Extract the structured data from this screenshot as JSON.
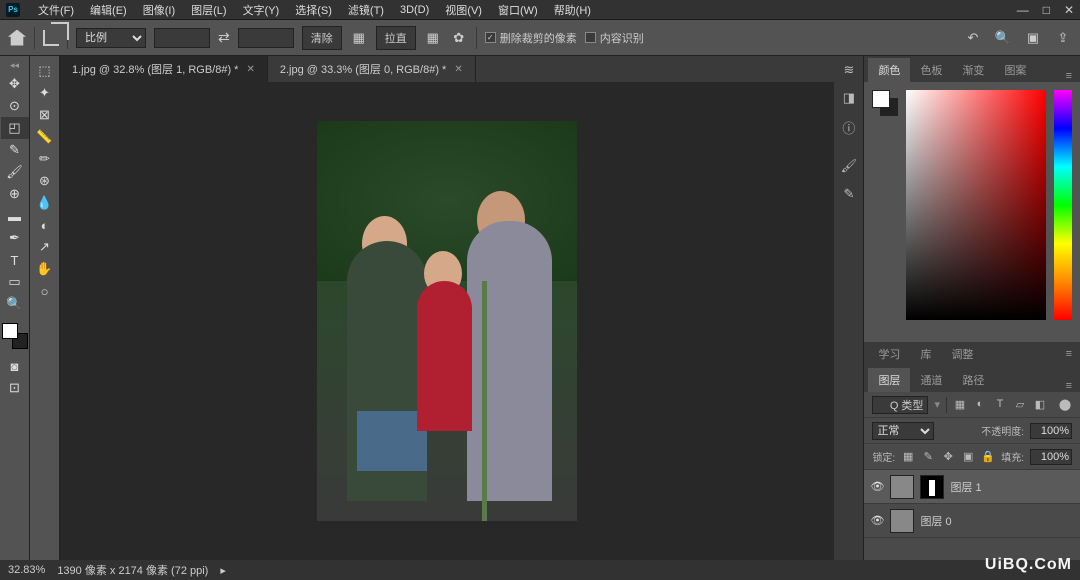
{
  "app": {
    "name": "Ps"
  },
  "menu": [
    "文件(F)",
    "编辑(E)",
    "图像(I)",
    "图层(L)",
    "文字(Y)",
    "选择(S)",
    "滤镜(T)",
    "3D(D)",
    "视图(V)",
    "窗口(W)",
    "帮助(H)"
  ],
  "winbtns": {
    "min": "—",
    "max": "□",
    "close": "✕"
  },
  "optbar": {
    "preset": "比例",
    "swap": "⇄",
    "clear": "清除",
    "straight": "拉直",
    "chk1": "删除裁剪的像素",
    "chk2": "内容识别"
  },
  "tabs": [
    {
      "label": "1.jpg @ 32.8% (图层 1, RGB/8#) *",
      "active": true
    },
    {
      "label": "2.jpg @ 33.3% (图层 0, RGB/8#) *",
      "active": false
    }
  ],
  "status": {
    "zoom": "32.83%",
    "dims": "1390 像素 x 2174 像素 (72 ppi)"
  },
  "colortabs": [
    "颜色",
    "色板",
    "渐变",
    "图案"
  ],
  "minitabs1": [
    "学习",
    "库",
    "调整"
  ],
  "layertabs": [
    "图层",
    "通道",
    "路径"
  ],
  "lp": {
    "kind": "Q 类型",
    "blend": "正常",
    "opLabel": "不透明度:",
    "opVal": "100%",
    "lockLabel": "锁定:",
    "fillLabel": "填充:",
    "fillVal": "100%"
  },
  "layers": [
    {
      "name": "图层 1",
      "sel": true,
      "mask": true
    },
    {
      "name": "图层 0",
      "sel": false,
      "mask": false
    }
  ],
  "watermark": "UiBQ.CoM"
}
